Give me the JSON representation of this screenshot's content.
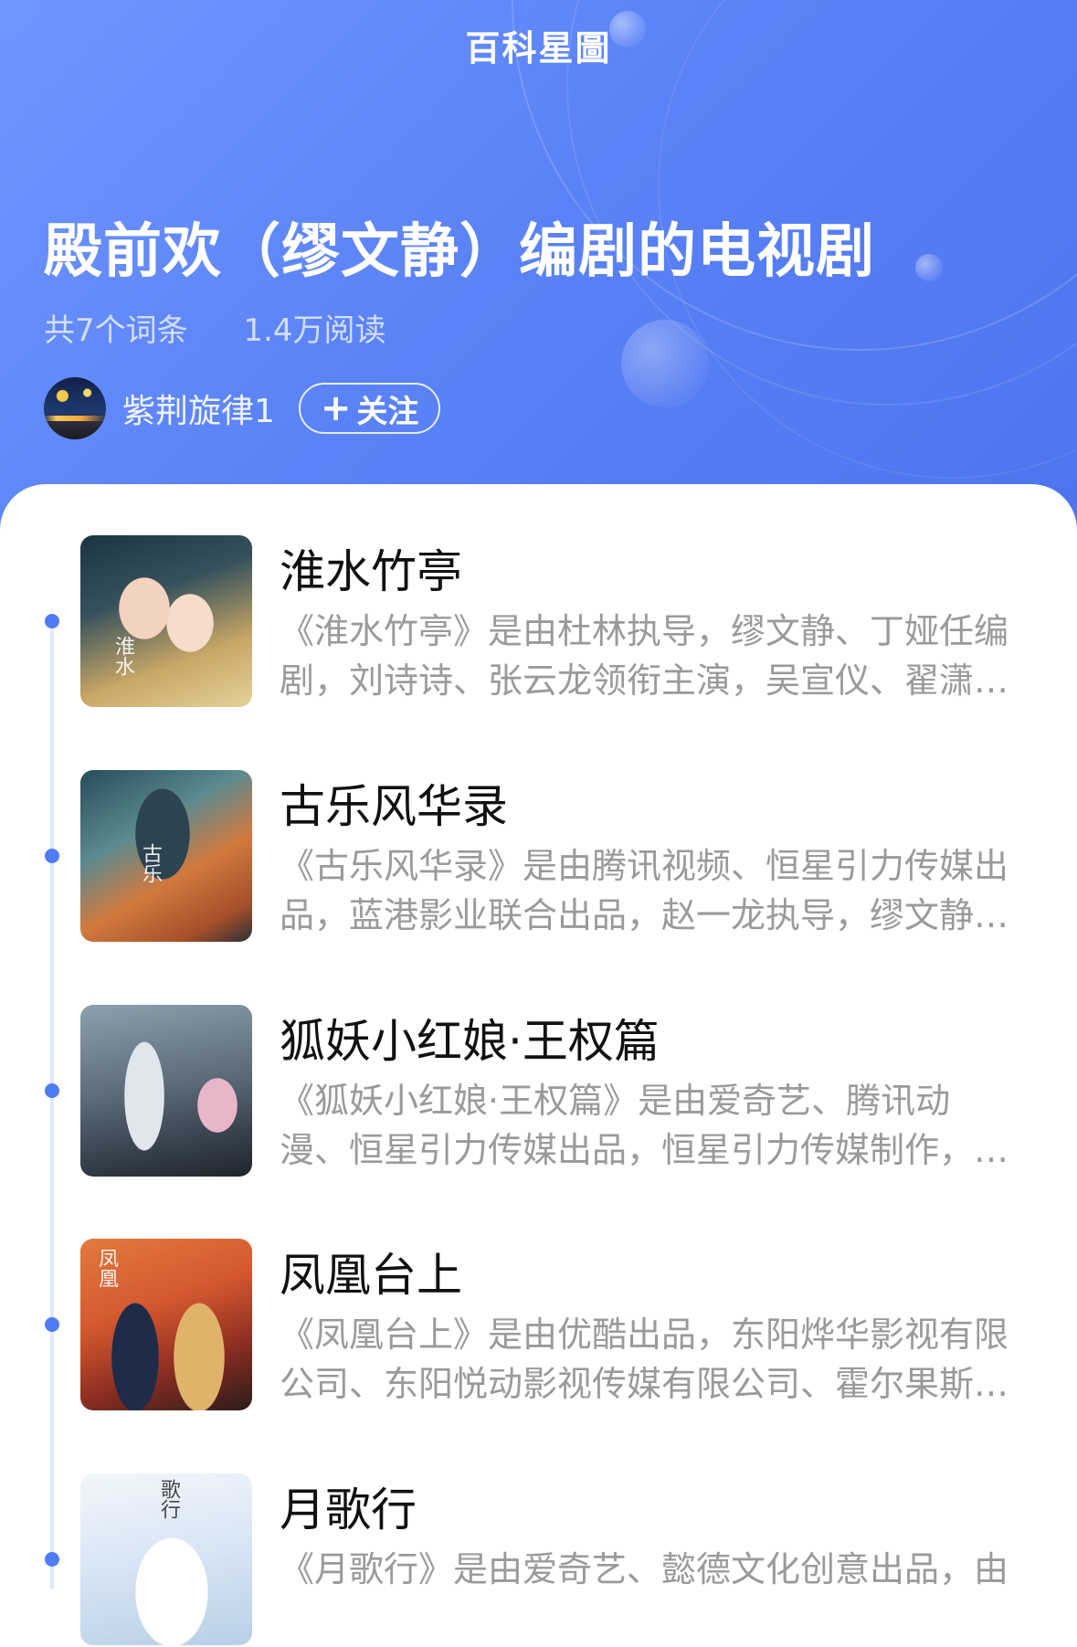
{
  "header": {
    "brand": "百科星圖",
    "title": "殿前欢（缪文静）编剧的电视剧",
    "entry_count": "共7个词条",
    "reads": "1.4万阅读",
    "author": "紫荆旋律1",
    "follow_label": "关注",
    "follow_icon": "plus-icon"
  },
  "items": [
    {
      "title": "淮水竹亭",
      "desc_line1": "《淮水竹亭》是由杜林执导，缪文静、丁娅任编",
      "desc_line2": "剧，刘诗诗、张云龙领衔主演，吴宣仪、翟潇…"
    },
    {
      "title": "古乐风华录",
      "desc_line1": "《古乐风华录》是由腾讯视频、恒星引力传媒出",
      "desc_line2": "品，蓝港影业联合出品，赵一龙执导，缪文静…"
    },
    {
      "title": "狐妖小红娘·王权篇",
      "desc_line1": "《狐妖小红娘·王权篇》是由爱奇艺、腾讯动",
      "desc_line2": "漫、恒星引力传媒出品，恒星引力传媒制作，…"
    },
    {
      "title": "凤凰台上",
      "desc_line1": "《凤凰台上》是由优酷出品，东阳烨华影视有限",
      "desc_line2": "公司、东阳悦动影视传媒有限公司、霍尔果斯…"
    },
    {
      "title": "月歌行",
      "desc_line1": "《月歌行》是由爱奇艺、懿德文化创意出品，由",
      "desc_line2": ""
    }
  ],
  "colors": {
    "accent": "#4f7bf3",
    "hero_start": "#6f95ff",
    "hero_end": "#4d74ee"
  }
}
